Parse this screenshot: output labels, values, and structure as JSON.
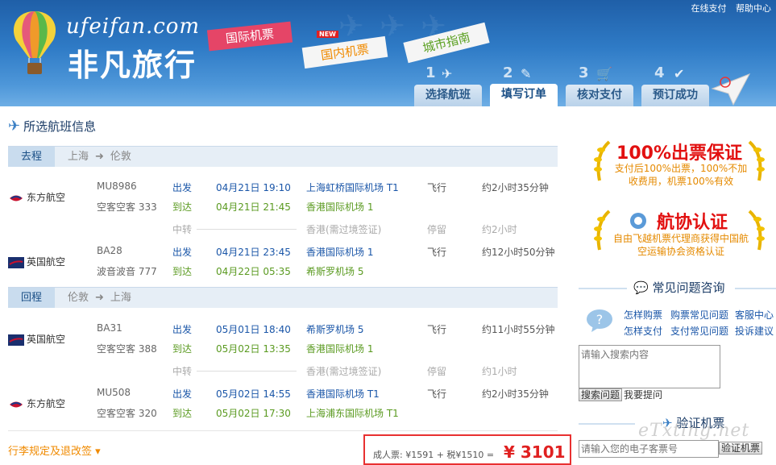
{
  "top_links": [
    "在线支付",
    "帮助中心"
  ],
  "logo": {
    "en": "ufeifan.com",
    "cn": "非凡旅行"
  },
  "nav": {
    "intl": "国际机票",
    "domestic": "国内机票",
    "domestic_badge": "NEW",
    "city": "城市指南"
  },
  "steps": [
    {
      "num": "1",
      "label": "选择航班"
    },
    {
      "num": "2",
      "label": "填写订单"
    },
    {
      "num": "3",
      "label": "核对支付"
    },
    {
      "num": "4",
      "label": "预订成功"
    }
  ],
  "section_title": "所选航班信息",
  "outbound": {
    "tag": "去程",
    "from": "上海",
    "to": "伦敦",
    "seg1": {
      "airline": "东方航空",
      "flight": "MU8986",
      "aircraft": "空客空客 333",
      "dep_label": "出发",
      "dep_time": "04月21日 19:10",
      "dep_airport": "上海虹桥国际机场 T1",
      "arr_label": "到达",
      "arr_time": "04月21日 21:45",
      "arr_airport": "香港国际机场 1",
      "fly": "飞行",
      "duration": "约2小时35分钟"
    },
    "transfer": {
      "label": "中转",
      "place": "香港(需过境签证)",
      "stop": "停留",
      "stop_time": "约2小时"
    },
    "seg2": {
      "airline": "英国航空",
      "flight": "BA28",
      "aircraft": "波音波音 777",
      "dep_label": "出发",
      "dep_time": "04月21日 23:45",
      "dep_airport": "香港国际机场 1",
      "arr_label": "到达",
      "arr_time": "04月22日 05:35",
      "arr_airport": "希斯罗机场 5",
      "fly": "飞行",
      "duration": "约12小时50分钟"
    }
  },
  "return": {
    "tag": "回程",
    "from": "伦敦",
    "to": "上海",
    "seg1": {
      "airline": "英国航空",
      "flight": "BA31",
      "aircraft": "空客空客 388",
      "dep_label": "出发",
      "dep_time": "05月01日 18:40",
      "dep_airport": "希斯罗机场 5",
      "arr_label": "到达",
      "arr_time": "05月02日 13:35",
      "arr_airport": "香港国际机场 1",
      "fly": "飞行",
      "duration": "约11小时55分钟"
    },
    "transfer": {
      "label": "中转",
      "place": "香港(需过境签证)",
      "stop": "停留",
      "stop_time": "约1小时"
    },
    "seg2": {
      "airline": "东方航空",
      "flight": "MU508",
      "aircraft": "空客空客 320",
      "dep_label": "出发",
      "dep_time": "05月02日 14:55",
      "dep_airport": "香港国际机场 T1",
      "arr_label": "到达",
      "arr_time": "05月02日 17:30",
      "arr_airport": "上海浦东国际机场 T1",
      "fly": "飞行",
      "duration": "约2小时35分钟"
    }
  },
  "rules_link": "行李规定及退改签 ▾",
  "price": {
    "label": "成人票:  ¥1591 + 税¥1510 =",
    "total": "¥ 3101"
  },
  "badge1": {
    "title": "100%出票保证",
    "desc": "支付后100%出票，100%不加收费用，机票100%有效"
  },
  "badge2": {
    "title": "航协认证",
    "desc": "自由飞越机票代理商获得中国航空运输协会资格认证"
  },
  "faq": {
    "title": "常见问题咨询",
    "links": [
      "怎样购票",
      "购票常见问题",
      "客服中心",
      "怎样支付",
      "支付常见问题",
      "投诉建议"
    ],
    "search_placeholder": "请输入搜索内容",
    "search_button": "搜索问题",
    "ask": "我要提问"
  },
  "verify": {
    "title": "验证机票",
    "placeholder": "请输入您的电子客票号",
    "button": "验证机票"
  },
  "watermark": "eTxting.net",
  "colors": {
    "header": "#2f7bc6",
    "price_border": "#e83030",
    "price": "#e02020",
    "depart": "#1a56a8",
    "arrive": "#5a9a20"
  }
}
